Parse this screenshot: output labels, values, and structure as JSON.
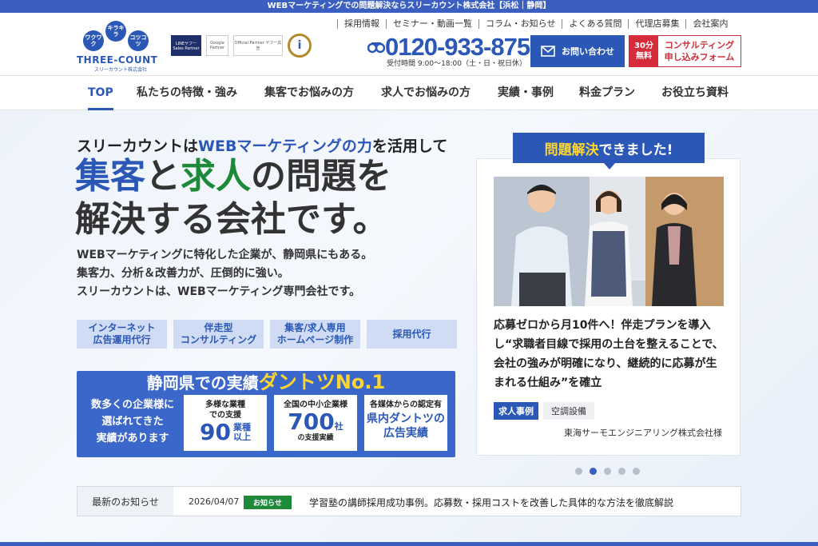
{
  "top_strip": {
    "text": "WEBマーケティングでの問題解決ならスリーカウント株式会社【浜松｜静岡】"
  },
  "logo": {
    "bubbles": [
      "ワクワク",
      "キラキラ",
      "コツコツ"
    ],
    "name": "THREE-COUNT",
    "sub": "スリーカウント株式会社"
  },
  "badges": [
    "LINEヤフー Sales Partner",
    "Google Partner",
    "Official Partner ヤフー広告",
    "i"
  ],
  "util_nav": [
    "採用情報",
    "セミナー・動画一覧",
    "コラム・お知らせ",
    "よくある質問",
    "代理店募集",
    "会社案内"
  ],
  "tel": {
    "number": "0120-933-875",
    "hours": "受付時間 9:00〜18:00（土・日・祝日休）",
    "icon": "free-dial-icon"
  },
  "contact_button": {
    "label": "お問い合わせ",
    "icon": "mail-icon"
  },
  "consult_button": {
    "tag": "30分\n無料",
    "label": "コンサルティング\n申し込みフォーム"
  },
  "main_nav": [
    "TOP",
    "私たちの特徴・強み",
    "集客でお悩みの方",
    "求人でお悩みの方",
    "実績・事例",
    "料金プラン",
    "お役立ち資料"
  ],
  "hero": {
    "line1_a": "スリーカウントは",
    "line1_b": "WEBマーケティングの力",
    "line1_c": "を活用して",
    "big_1": "集客",
    "big_2": "と",
    "big_3": "求人",
    "big_4": "の問題を",
    "big_5": "解決する会社です。",
    "desc": [
      "WEBマーケティングに特化した企業が、静岡県にもある。",
      "集客力、分析＆改善力が、圧倒的に強い。",
      "スリーカウントは、WEBマーケティング専門会社です。"
    ]
  },
  "services": [
    "インターネット\n広告運用代行",
    "伴走型\nコンサルティング",
    "集客/求人専用\nホームページ制作",
    "採用代行"
  ],
  "record": {
    "title_a": "静岡県",
    "title_b": "での実績",
    "title_c": "ダントツNo.1",
    "left_text": "数多くの企業様に\n選ばれてきた\n実績があります",
    "card1": {
      "top": "多様な業種\nでの支援",
      "big": "90",
      "unit": "業種\n以上"
    },
    "card2": {
      "top": "全国の中小企業様",
      "big": "700",
      "unit": "社",
      "bottom": "の支援実績"
    },
    "card3": {
      "top": "各媒体からの認定有",
      "big_a": "県内ダントツの",
      "big_b": "広告実績"
    }
  },
  "case": {
    "label_a": "問題解決",
    "label_b": "できました!",
    "text": "応募ゼロから月10件へ！伴走プランを導入し“求職者目線で採用の土台を整えることで、会社の強みが明確になり、継続的に応募が生まれる仕組み”を確立",
    "tag1": "求人事例",
    "tag2": "空調設備",
    "company": "東海サーモエンジニアリング株式会社様"
  },
  "carousel": {
    "count": 5,
    "active": 2
  },
  "news": {
    "head": "最新のお知らせ",
    "date": "2026/04/07",
    "category": "お知らせ",
    "title": "学習塾の講師採用成功事例。応募数・採用コストを改善した具体的な方法を徹底解説"
  }
}
